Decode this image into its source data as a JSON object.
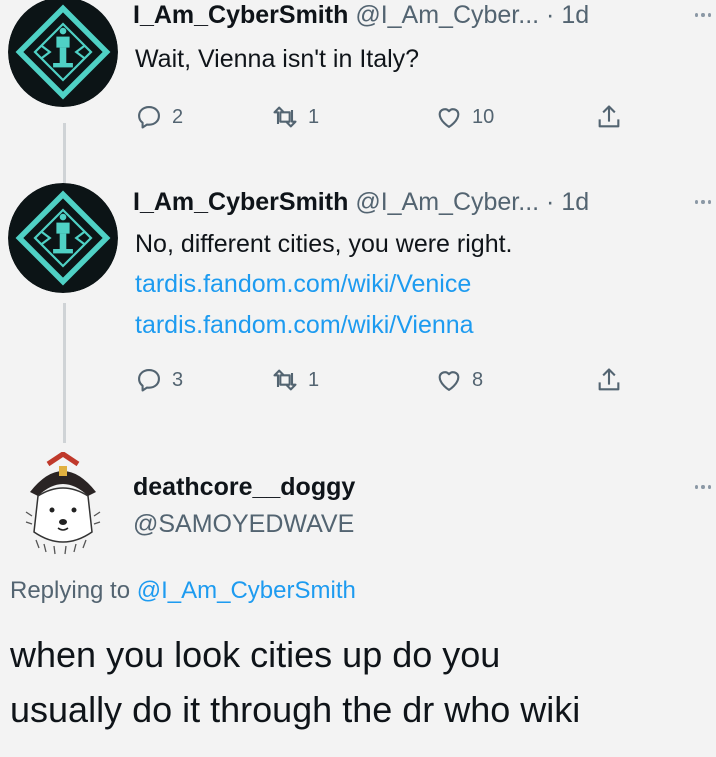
{
  "tweets": [
    {
      "display_name": "I_Am_CyberSmith",
      "handle": "@I_Am_Cyber...",
      "separator": "·",
      "time": "1d",
      "text": "Wait, Vienna isn't in Italy?",
      "links": [],
      "reply_count": "2",
      "retweet_count": "1",
      "like_count": "10"
    },
    {
      "display_name": "I_Am_CyberSmith",
      "handle": "@I_Am_Cyber...",
      "separator": "·",
      "time": "1d",
      "text": "No, different cities, you were right.",
      "links": [
        "tardis.fandom.com/wiki/Venice",
        "tardis.fandom.com/wiki/Vienna"
      ],
      "reply_count": "3",
      "retweet_count": "1",
      "like_count": "8"
    }
  ],
  "main_tweet": {
    "display_name": "deathcore__doggy",
    "handle": "@SAMOYEDWAVE",
    "replying_prefix": "Replying to",
    "replying_to": "@I_Am_CyberSmith",
    "text_line1": "when you look cities up do you",
    "text_line2": "usually do it through the dr who wiki"
  },
  "icons": {
    "reply": "reply-icon",
    "retweet": "retweet-icon",
    "like": "heart-icon",
    "share": "share-icon",
    "more": "more-icon"
  },
  "colors": {
    "background": "#f3f3f3",
    "link": "#1d9bf0",
    "muted": "#536471",
    "avatar_teal": "#4fd1c5",
    "thread_line": "#cfd3d6"
  }
}
